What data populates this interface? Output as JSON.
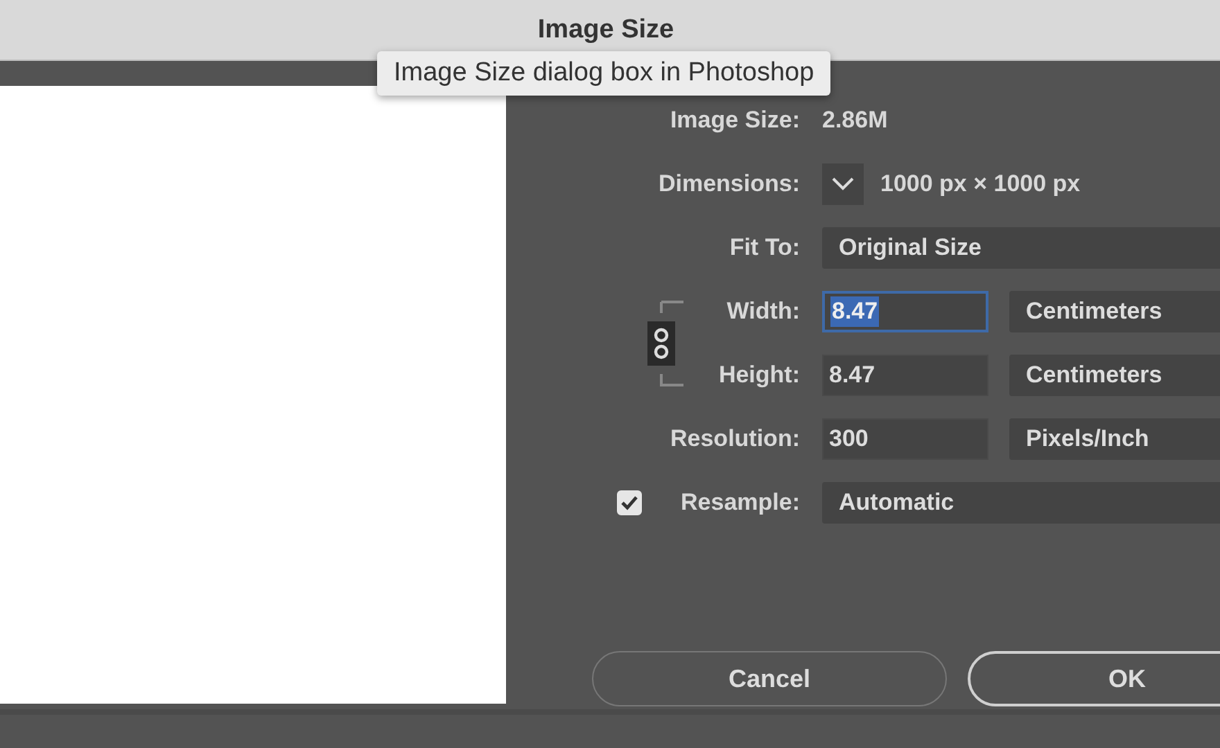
{
  "window": {
    "title": "Image Size"
  },
  "tooltip": {
    "text": "Image Size dialog box in Photoshop"
  },
  "image_size": {
    "label": "Image Size:",
    "value": "2.86M"
  },
  "dimensions": {
    "label": "Dimensions:",
    "value": "1000 px × 1000 px"
  },
  "fit_to": {
    "label": "Fit To:",
    "value": "Original Size"
  },
  "size_fields": [
    {
      "label": "Width:",
      "value": "8.47",
      "unit": "Centimeters",
      "focused": true
    },
    {
      "label": "Height:",
      "value": "8.47",
      "unit": "Centimeters",
      "focused": false
    }
  ],
  "resolution": {
    "label": "Resolution:",
    "value": "300",
    "unit": "Pixels/Inch"
  },
  "resample": {
    "label": "Resample:",
    "checked": true,
    "value": "Automatic"
  },
  "buttons": [
    {
      "label": "Cancel",
      "default": false
    },
    {
      "label": "OK",
      "default": true
    }
  ]
}
